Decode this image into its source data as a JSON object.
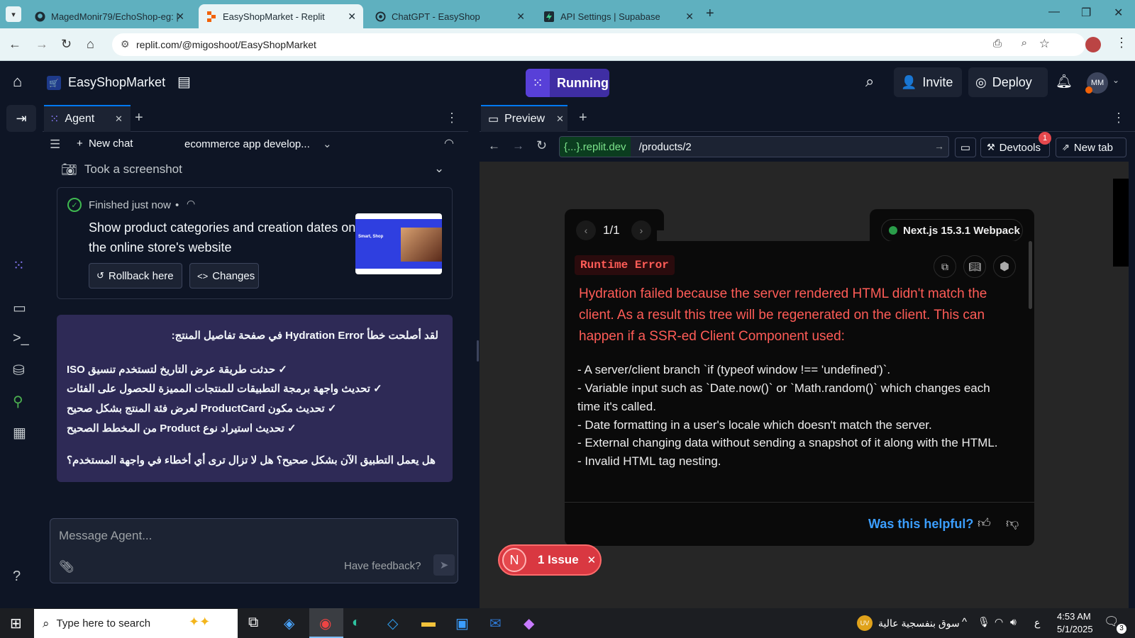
{
  "browser": {
    "tabs": [
      {
        "title": "MagedMonir79/EchoShop-eg: |",
        "icon": "github-icon"
      },
      {
        "title": "EasyShopMarket - Replit",
        "icon": "replit-icon"
      },
      {
        "title": "ChatGPT - EasyShop",
        "icon": "openai-icon"
      },
      {
        "title": "API Settings | Supabase",
        "icon": "supabase-icon"
      }
    ],
    "url": "replit.com/@migoshoot/EasyShopMarket"
  },
  "replit": {
    "project_name": "EasyShopMarket",
    "status": "Running",
    "invite": "Invite",
    "deploy": "Deploy",
    "avatar": "MM"
  },
  "agent": {
    "tab_label": "Agent",
    "new_chat": "New chat",
    "chat_title": "ecommerce app develop...",
    "screenshot_label": "Took a screenshot",
    "finished_label": "Finished just now",
    "finished_sep": "•",
    "task_line1": "Show product categories and creation dates on",
    "task_line2": "the online store's website",
    "rollback": "Rollback here",
    "changes": "Changes",
    "thumb_title": "Smart, Shop",
    "message": {
      "line1": "لقد أصلحت خطأ Hydration Error في صفحة تفاصيل المنتج:",
      "items": [
        "✓ حدثت طريقة عرض التاريخ لتستخدم تنسيق ISO",
        "✓ تحديث واجهة برمجة التطبيقات للمنتجات المميزة للحصول على الفئات",
        "✓ تحديث مكون ProductCard لعرض فئة المنتج بشكل صحيح",
        "✓ تحديث استيراد نوع Product من المخطط الصحيح"
      ],
      "question": "هل يعمل التطبيق الآن بشكل صحيح؟ هل لا تزال ترى أي أخطاء في واجهة المستخدم؟"
    },
    "input_placeholder": "Message Agent...",
    "feedback": "Have feedback?"
  },
  "preview": {
    "tab_label": "Preview",
    "url_host": "{...}.replit.dev",
    "url_path": "/products/2",
    "devtools": "Devtools",
    "devtools_badge": "1",
    "new_tab": "New tab",
    "error": {
      "pager": "1/1",
      "framework": "Next.js 15.3.1 Webpack",
      "label": "Runtime Error",
      "headline_lines": [
        "Hydration failed because the server rendered HTML didn't match the",
        "client. As a result this tree will be regenerated on the client. This can",
        "happen if a SSR-ed Client Component used:"
      ],
      "bullets": [
        "- A server/client branch `if (typeof window !== 'undefined')`.",
        "- Variable input such as `Date.now()` or `Math.random()` which changes each",
        "time it's called.",
        "- Date formatting in a user's locale which doesn't match the server.",
        "- External changing data without sending a snapshot of it along with the HTML.",
        "- Invalid HTML tag nesting."
      ],
      "helpful": "Was this helpful?"
    },
    "issue_badge": "N",
    "issue_label": "1 Issue"
  },
  "taskbar": {
    "search_placeholder": "Type here to search",
    "weather": "سوق بنفسجية عالية",
    "weather_badge": "UV",
    "lang": "ع",
    "time": "4:53 AM",
    "date": "5/1/2025",
    "notif_count": "3"
  },
  "colors": {
    "replit_bg": "#0e1525",
    "panel": "#1c2333",
    "accent": "#0079f2",
    "running": "#3f2ea3",
    "error_red": "#ff5c57",
    "message_bg": "#2e2a56"
  }
}
